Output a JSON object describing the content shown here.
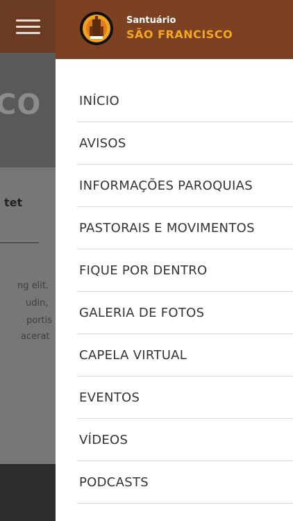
{
  "background_page": {
    "hero_text": "CO",
    "heading": "tet",
    "lines": [
      "ng elit.",
      "udin,",
      "portis",
      "acerat"
    ]
  },
  "drawer": {
    "brand": {
      "small": "Santuário",
      "name": "SÃO FRANCISCO",
      "accent_color": "#f5a623",
      "header_color": "#7b4121"
    },
    "menu": [
      {
        "label": "INÍCIO"
      },
      {
        "label": "AVISOS"
      },
      {
        "label": "INFORMAÇÕES PAROQUIAS"
      },
      {
        "label": "PASTORAIS E MOVIMENTOS"
      },
      {
        "label": "FIQUE POR DENTRO"
      },
      {
        "label": "GALERIA DE FOTOS"
      },
      {
        "label": "CAPELA VIRTUAL"
      },
      {
        "label": "EVENTOS"
      },
      {
        "label": "VÍDEOS"
      },
      {
        "label": "PODCASTS"
      }
    ]
  }
}
